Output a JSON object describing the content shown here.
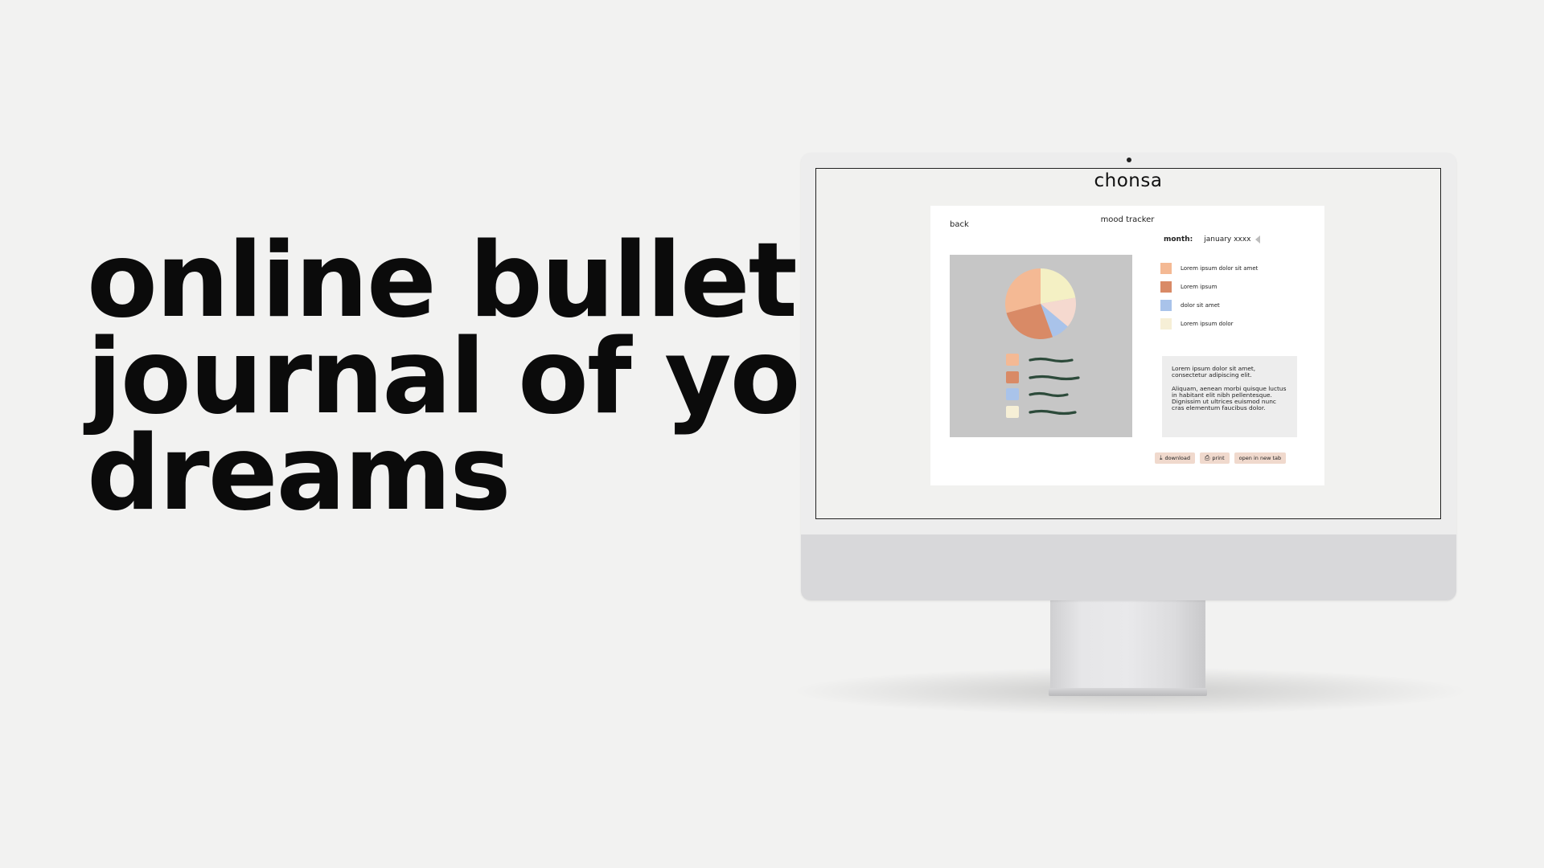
{
  "headline": {
    "line1": "online bullet",
    "line2": "journal of your",
    "line3": "dreams"
  },
  "screen": {
    "brand": "chonsa",
    "app": {
      "back_label": "back",
      "title": "mood tracker",
      "month_label": "month:",
      "month_value": "january xxxx",
      "legend": [
        {
          "label": "Lorem ipsum dolor sit amet",
          "color": "#f4b994"
        },
        {
          "label": "Lorem ipsum",
          "color": "#d98a66"
        },
        {
          "label": "dolor sit amet",
          "color": "#a9c3ea"
        },
        {
          "label": "Lorem ipsum dolor",
          "color": "#f6efd6"
        }
      ],
      "note": {
        "paragraph1": "Lorem ipsum dolor sit amet, consectetur adipiscing elit.",
        "paragraph2": "Aliquam, aenean morbi quisque luctus in habitant elit nibh pellentesque. Dignissim ut ultrices euismod nunc cras elementum faucibus dolor."
      },
      "actions": {
        "download": "download",
        "print": "print",
        "open_new_tab": "open in new tab"
      }
    }
  },
  "pie": {
    "colors": [
      "#f4b994",
      "#f4f0c4",
      "#f5d9cf",
      "#a9c3ea",
      "#d98a66"
    ],
    "line_color": "#2c4a3a",
    "chip_colors": [
      "#f4b994",
      "#d98a66",
      "#a9c3ea",
      "#f6efd6"
    ]
  }
}
